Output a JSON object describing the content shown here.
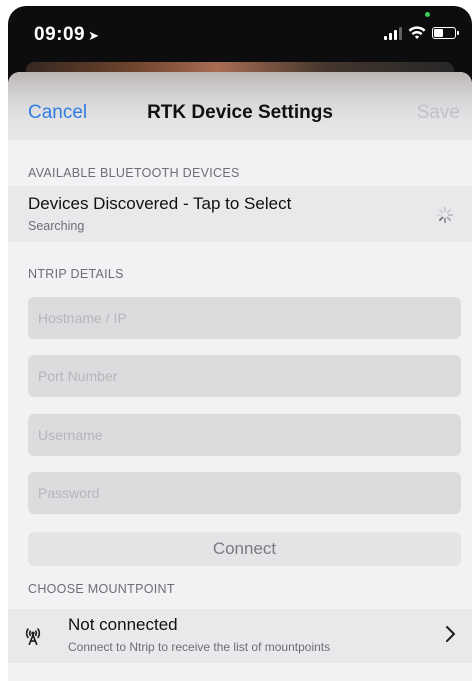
{
  "status_bar": {
    "time": "09:09",
    "location_icon": "location-arrow-icon",
    "signal_icon": "cellular-signal-icon",
    "wifi_icon": "wifi-icon",
    "battery_icon": "battery-icon",
    "battery_level": 0.45
  },
  "nav": {
    "cancel_label": "Cancel",
    "title": "RTK Device Settings",
    "save_label": "Save"
  },
  "bluetooth": {
    "header": "AVAILABLE BLUETOOTH DEVICES",
    "title": "Devices Discovered - Tap to Select",
    "status": "Searching",
    "spinner_icon": "activity-spinner-icon"
  },
  "ntrip": {
    "header": "NTRIP DETAILS",
    "hostname_placeholder": "Hostname / IP",
    "port_placeholder": "Port Number",
    "username_placeholder": "Username",
    "password_placeholder": "Password",
    "hostname_value": "",
    "port_value": "",
    "username_value": "",
    "password_value": "",
    "connect_label": "Connect"
  },
  "mountpoint": {
    "header": "CHOOSE MOUNTPOINT",
    "title": "Not connected",
    "subtitle": "Connect to Ntrip to receive the list of mountpoints",
    "icon": "antenna-broadcast-icon",
    "chevron_icon": "chevron-right-icon"
  },
  "colors": {
    "accent": "#2f7de1",
    "disabled": "#c2c2c6",
    "secondary_text": "#6e6e73"
  }
}
